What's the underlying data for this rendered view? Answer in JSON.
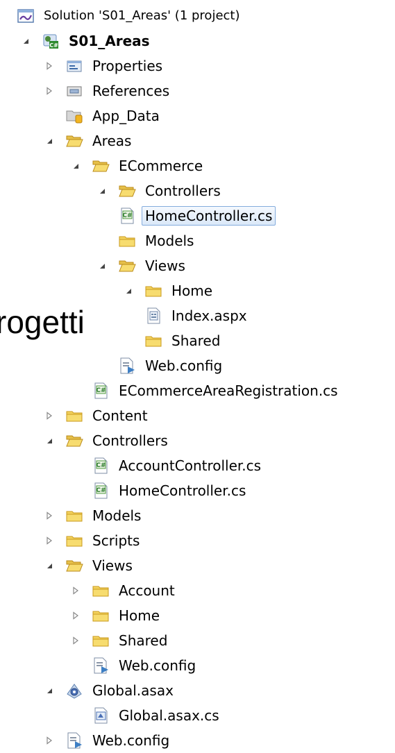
{
  "overlay": {
    "text": "rogetti"
  },
  "tree": {
    "solution": {
      "label": "Solution 'S01_Areas' (1 project)",
      "icon": "solution-icon"
    },
    "project": {
      "label": "S01_Areas",
      "icon": "csharp-project-icon",
      "expanded": true
    },
    "items": [
      {
        "label": "Properties",
        "icon": "properties-icon",
        "expander": "collapsed"
      },
      {
        "label": "References",
        "icon": "references-icon",
        "expander": "collapsed"
      },
      {
        "label": "App_Data",
        "icon": "app-data-folder-icon",
        "expander": "none"
      },
      {
        "label": "Areas",
        "icon": "folder-open-icon",
        "expander": "expanded"
      },
      {
        "label": "ECommerce",
        "icon": "folder-open-icon",
        "expander": "expanded"
      },
      {
        "label": "Controllers",
        "icon": "folder-open-icon",
        "expander": "expanded"
      },
      {
        "label": "HomeController.cs",
        "icon": "csharp-file-icon",
        "expander": "none",
        "selected": true
      },
      {
        "label": "Models",
        "icon": "folder-icon",
        "expander": "none"
      },
      {
        "label": "Views",
        "icon": "folder-open-icon",
        "expander": "expanded"
      },
      {
        "label": "Home",
        "icon": "folder-icon",
        "expander": "expanded"
      },
      {
        "label": "Index.aspx",
        "icon": "aspx-file-icon",
        "expander": "none"
      },
      {
        "label": "Shared",
        "icon": "folder-icon",
        "expander": "none"
      },
      {
        "label": "Web.config",
        "icon": "config-file-icon",
        "expander": "none"
      },
      {
        "label": "ECommerceAreaRegistration.cs",
        "icon": "csharp-file-icon",
        "expander": "none"
      },
      {
        "label": "Content",
        "icon": "folder-icon",
        "expander": "collapsed"
      },
      {
        "label": "Controllers",
        "icon": "folder-open-icon",
        "expander": "expanded"
      },
      {
        "label": "AccountController.cs",
        "icon": "csharp-file-icon",
        "expander": "none"
      },
      {
        "label": "HomeController.cs",
        "icon": "csharp-file-icon",
        "expander": "none"
      },
      {
        "label": "Models",
        "icon": "folder-icon",
        "expander": "collapsed"
      },
      {
        "label": "Scripts",
        "icon": "folder-icon",
        "expander": "collapsed"
      },
      {
        "label": "Views",
        "icon": "folder-open-icon",
        "expander": "expanded"
      },
      {
        "label": "Account",
        "icon": "folder-icon",
        "expander": "collapsed"
      },
      {
        "label": "Home",
        "icon": "folder-icon",
        "expander": "collapsed"
      },
      {
        "label": "Shared",
        "icon": "folder-icon",
        "expander": "collapsed"
      },
      {
        "label": "Web.config",
        "icon": "config-file-icon",
        "expander": "none"
      },
      {
        "label": "Global.asax",
        "icon": "asax-file-icon",
        "expander": "expanded"
      },
      {
        "label": "Global.asax.cs",
        "icon": "asax-cs-file-icon",
        "expander": "none"
      },
      {
        "label": "Web.config",
        "icon": "config-file-icon",
        "expander": "collapsed"
      }
    ]
  }
}
